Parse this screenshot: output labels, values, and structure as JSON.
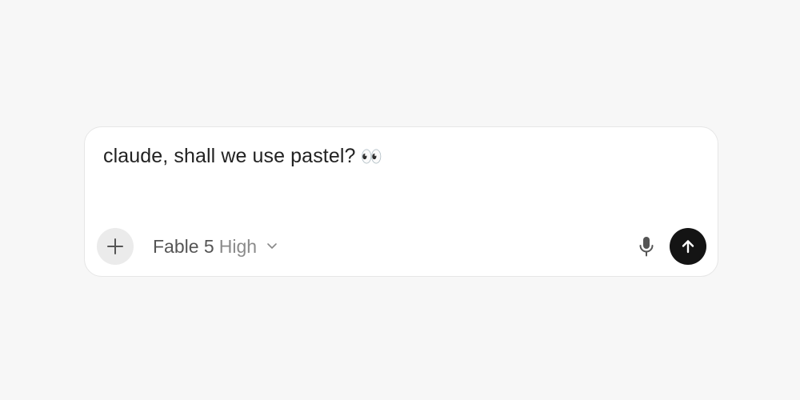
{
  "composer": {
    "message": "claude, shall we use pastel?",
    "emoji": "👀",
    "add_icon": "plus-icon",
    "model_selector": {
      "model": "Fable 5",
      "level": "High",
      "icon": "chevron-down-icon"
    },
    "mic_icon": "microphone-icon",
    "send_icon": "arrow-up-icon"
  },
  "colors": {
    "page_background": "#f7f7f7",
    "composer_background": "#ffffff",
    "send_button": "#141414",
    "add_button": "#ebebeb"
  }
}
